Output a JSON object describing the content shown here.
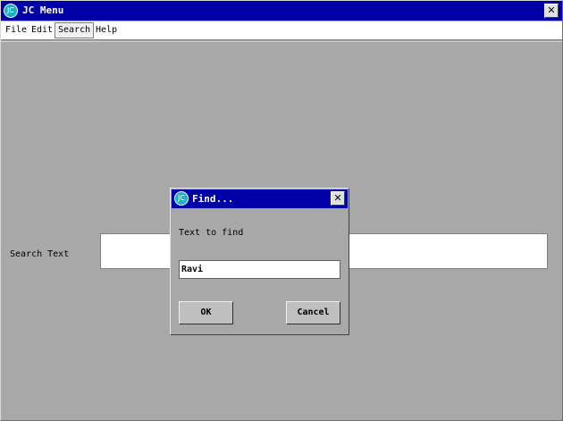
{
  "window": {
    "title": "JC Menu",
    "logo": "JC",
    "close_glyph": "✕"
  },
  "menubar": {
    "items": [
      {
        "label": "File"
      },
      {
        "label": "Edit"
      },
      {
        "label": "Search",
        "active": true
      },
      {
        "label": "Help"
      }
    ]
  },
  "main": {
    "search_label": "Search Text",
    "search_value": ""
  },
  "dialog": {
    "title": "Find...",
    "logo": "JC",
    "close_glyph": "✕",
    "prompt": "Text to find",
    "input_value": "Ravi",
    "ok_label": "OK",
    "cancel_label": "Cancel"
  },
  "colors": {
    "titlebar": "#0000a8",
    "background": "#a8a8a8",
    "logo": "#19b3c1"
  }
}
